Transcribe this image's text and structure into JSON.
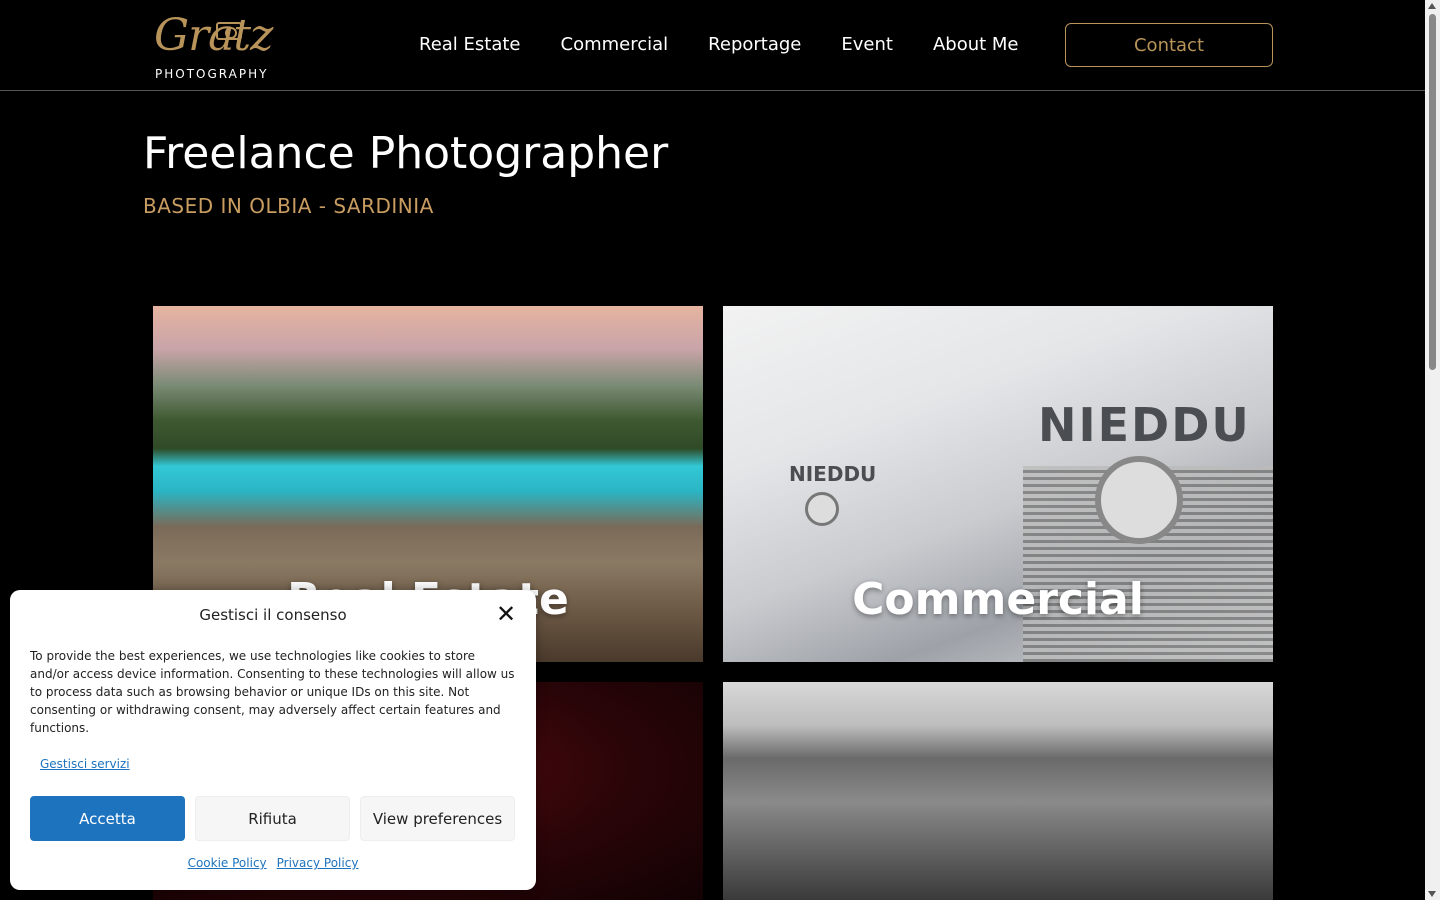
{
  "header": {
    "logo_script": "Gratz",
    "logo_sub": "PHOTOGRAPHY",
    "nav": [
      "Real Estate",
      "Commercial",
      "Reportage",
      "Event",
      "About Me"
    ],
    "contact_label": "Contact"
  },
  "hero": {
    "title": "Freelance Photographer",
    "subtitle": "BASED IN OLBIA - SARDINIA"
  },
  "cards": {
    "real_estate": "Real Estate",
    "commercial": "Commercial",
    "truck_brand": "NIEDDU"
  },
  "cookie": {
    "title": "Gestisci il consenso",
    "text": "To provide the best experiences, we use technologies like cookies to store and/or access device information. Consenting to these technologies will allow us to process data such as browsing behavior or unique IDs on this site. Not consenting or withdrawing consent, may adversely affect certain features and functions.",
    "manage_link": "Gestisci servizi",
    "accept": "Accetta",
    "refuse": "Rifiuta",
    "view": "View preferences",
    "cookie_policy": "Cookie Policy",
    "privacy_policy": "Privacy Policy"
  },
  "colors": {
    "accent_gold": "#b8935a",
    "cookie_blue": "#1e73be"
  }
}
